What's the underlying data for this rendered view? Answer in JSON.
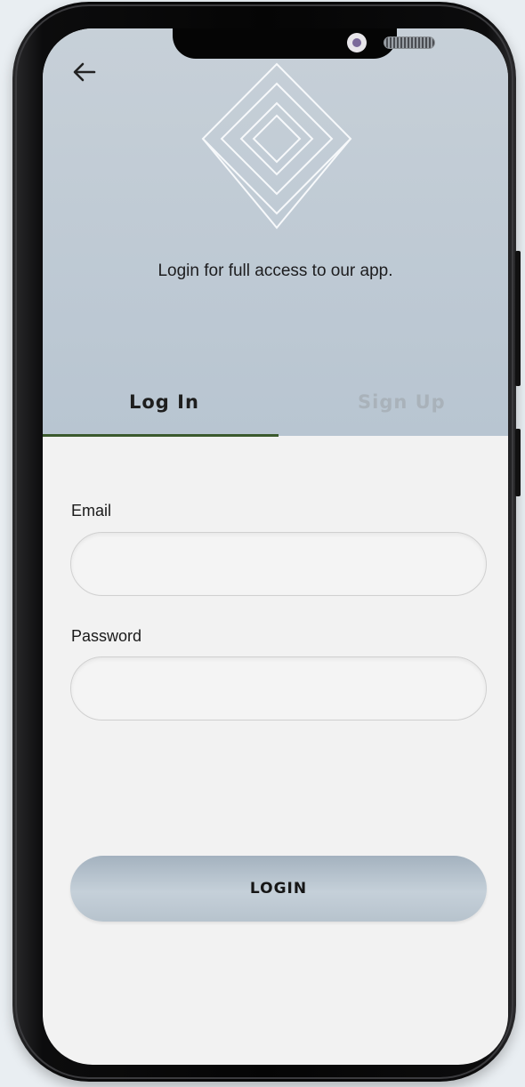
{
  "header": {
    "subtitle": "Login for full access to our app."
  },
  "tabs": [
    {
      "label": "Log In",
      "active": true
    },
    {
      "label": "Sign Up",
      "active": false
    }
  ],
  "form": {
    "email_label": "Email",
    "email_value": "",
    "password_label": "Password",
    "password_value": "",
    "submit_label": "LOGIN"
  },
  "icons": {
    "back": "arrow-left-icon",
    "logo": "diamond-logo"
  },
  "colors": {
    "header_background": "#bcc8d3",
    "active_tab_indicator": "#3b5a2e",
    "inactive_tab_text": "#a9b2ba",
    "button_background": "#b7c3cd"
  }
}
